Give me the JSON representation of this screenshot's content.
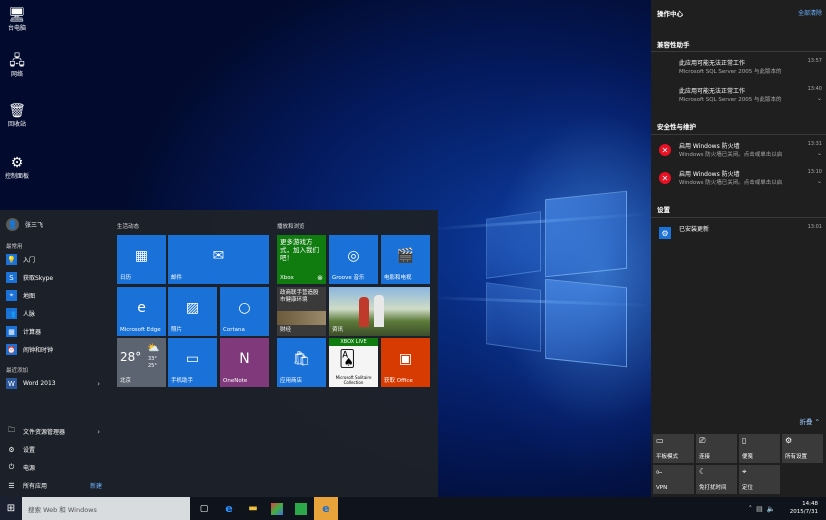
{
  "desktop": {
    "icons": [
      {
        "label": "台电脑",
        "icon": "computer-icon"
      },
      {
        "label": "网络",
        "icon": "network-icon"
      },
      {
        "label": "回收站",
        "icon": "recycle-bin-icon"
      },
      {
        "label": "控制面板",
        "icon": "control-panel-icon"
      }
    ]
  },
  "start": {
    "user": "张三飞",
    "most_used_label": "最常用",
    "recent_label": "最近添加",
    "apps": [
      "入门",
      "获取Skype",
      "地图",
      "人脉",
      "计算器",
      "闹钟和时钟"
    ],
    "recent": [
      "Word 2013"
    ],
    "bottom": [
      "文件资源管理器",
      "设置",
      "电源",
      "所有应用"
    ],
    "new_badge": "新建",
    "groups": [
      "生活动态",
      "播放和浏览"
    ],
    "tiles": {
      "calendar": "日历",
      "mail": "邮件",
      "edge": "Microsoft Edge",
      "photos": "照片",
      "cortana": "Cortana",
      "weather_temp": "28°",
      "weather_hi": "33°",
      "weather_lo": "25°",
      "weather_city": "北京",
      "phone": "手机助手",
      "onenote": "OneNote",
      "xbox_text": "更多游戏方式，加入我们吧！",
      "xbox": "Xbox",
      "groove": "Groove 音乐",
      "movies": "电影和电视",
      "finance_text": "政商联手营造股市健康环境",
      "finance": "财经",
      "news": "资讯",
      "store": "应用商店",
      "xbox_live": "XBOX LIVE",
      "solitaire": "Microsoft Solitaire Collection",
      "get_office": "获取 Office"
    }
  },
  "action_center": {
    "title": "操作中心",
    "clear_all": "全部清除",
    "groups": [
      {
        "name": "兼容性助手",
        "items": [
          {
            "title": "此应用可能无法正常工作",
            "body": "Microsoft SQL Server 2005 与此版本的",
            "time": "13:57"
          },
          {
            "title": "此应用可能无法正常工作",
            "body": "Microsoft SQL Server 2005 与此版本的",
            "time": "13:40"
          }
        ]
      },
      {
        "name": "安全性与维护",
        "items": [
          {
            "title": "启用 Windows 防火墙",
            "body": "Windows 防火墙已关闭。点击或单击以启",
            "time": "13:31"
          },
          {
            "title": "启用 Windows 防火墙",
            "body": "Windows 防火墙已关闭。点击或单击以启",
            "time": "13:10"
          }
        ]
      },
      {
        "name": "设置",
        "items": [
          {
            "title": "已安装更新",
            "body": "",
            "time": "13:01"
          }
        ]
      }
    ],
    "collapse": "折叠",
    "quick_actions": [
      "平板模式",
      "连接",
      "便笺",
      "所有设置",
      "VPN",
      "免打扰时间",
      "定位"
    ]
  },
  "taskbar": {
    "search_placeholder": "搜索 Web 和 Windows",
    "time": "14:48",
    "date": "2015/7/31"
  },
  "colors": {
    "accent": "#1a72d8",
    "xbox_green": "#107c10",
    "onenote": "#80397b",
    "office": "#d83b01",
    "error": "#e81123"
  }
}
